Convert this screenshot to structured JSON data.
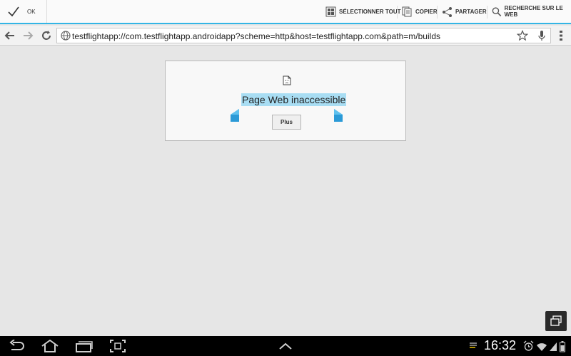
{
  "action_bar": {
    "done_label": "OK",
    "actions": [
      {
        "label": "SÉLECTIONNER TOUT",
        "icon": "select-all-icon"
      },
      {
        "label": "COPIER",
        "icon": "copy-icon"
      },
      {
        "label": "PARTAGER",
        "icon": "share-icon"
      },
      {
        "label": "RECHERCHE SUR LE WEB",
        "icon": "search-icon"
      }
    ],
    "accent_color": "#33b5e5"
  },
  "url_bar": {
    "url": "testflightapp://com.testflightapp.androidapp?scheme=http&host=testflightapp.com&path=m/builds"
  },
  "error_card": {
    "title": "Page Web inaccessible",
    "more_button": "Plus",
    "selection_color": "#a8ddf3"
  },
  "status_bar": {
    "time": "16:32"
  }
}
